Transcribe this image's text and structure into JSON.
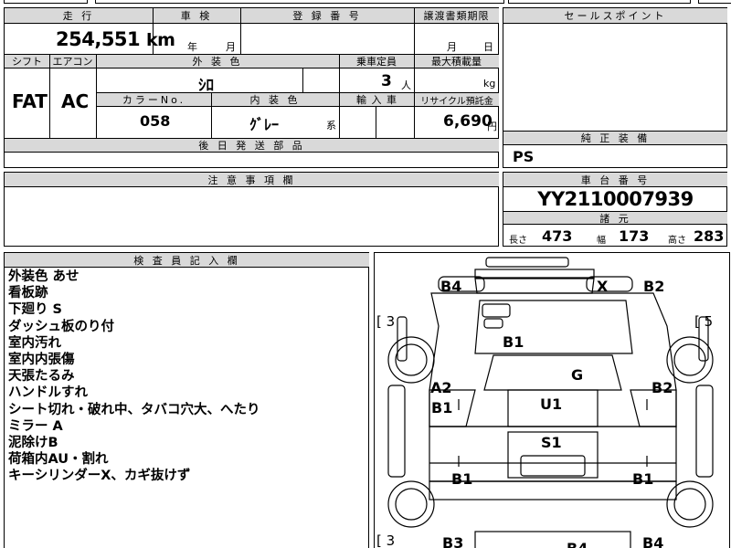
{
  "top_row": {
    "partial_left": "",
    "partial_mid": ""
  },
  "mileage": {
    "header": "走 行",
    "value": "254,551",
    "unit": "km"
  },
  "inspection": {
    "header": "車 検",
    "year_unit": "年",
    "month_unit": "月"
  },
  "registration": {
    "header": "登 録 番 号",
    "value": ""
  },
  "transfer_deadline": {
    "header": "譲渡書類期限",
    "month_unit": "月",
    "day_unit": "日"
  },
  "sales_point": {
    "header": "セールスポイント",
    "value": ""
  },
  "shift": {
    "header": "シフト",
    "value": "FAT"
  },
  "aircon": {
    "header": "エアコン",
    "value": "AC"
  },
  "exterior_color": {
    "header": "外 装 色",
    "value": "ｼﾛ"
  },
  "color_no": {
    "header": "カラーNo.",
    "value": "058"
  },
  "interior_color": {
    "header": "内 装 色",
    "value": "ｸﾞﾚｰ",
    "suffix": "系"
  },
  "capacity": {
    "header": "乗車定員",
    "value": "3",
    "unit": "人"
  },
  "import": {
    "header": "輸 入 車",
    "value": ""
  },
  "max_load": {
    "header": "最大積載量",
    "value": "",
    "unit": "kg"
  },
  "recycle": {
    "header": "リサイクル預託金",
    "value": "6,690",
    "unit": "円"
  },
  "later_parts": {
    "header": "後 日 発 送 部 品",
    "value": ""
  },
  "genuine_equipment": {
    "header": "純 正 装 備",
    "value": "PS"
  },
  "notes": {
    "header": "注 意 事 項 欄",
    "value": ""
  },
  "chassis": {
    "header": "車 台 番 号",
    "value": "YY2110007939"
  },
  "specs": {
    "header": "諸 元",
    "length_label": "長さ",
    "length_value": "473",
    "width_label": "幅",
    "width_value": "173",
    "height_label": "高さ",
    "height_value": "283"
  },
  "inspector": {
    "header": "検 査 員 記 入 欄",
    "remarks": [
      "外装色 あせ",
      "看板跡",
      "下廻り S",
      "ダッシュ板のり付",
      "室内汚れ",
      "室内内張傷",
      "天張たるみ",
      "ハンドルすれ",
      "シート切れ・破れ中、タバコ穴大、へたり",
      "ミラー A",
      "泥除けB",
      "荷箱内AU・割れ",
      "キーシリンダーX、カギ抜けず"
    ]
  },
  "diagram": {
    "labels": {
      "front_left_corner": "B4",
      "front_center": "X",
      "front_right_corner": "B2",
      "left_top_bracket": "[ 3",
      "right_top_bracket": "[ 5",
      "hood": "B1",
      "windshield": "G",
      "left_front_door": "A2",
      "left_front_panel": "B1",
      "roof_top": "U1",
      "right_front_door": "B2",
      "bed_center": "S1",
      "left_rear": "B1",
      "right_rear": "B1",
      "left_bottom_bracket": "[ 3",
      "rear_left": "B3",
      "rear_center": "B4",
      "rear_right": "B4"
    }
  }
}
